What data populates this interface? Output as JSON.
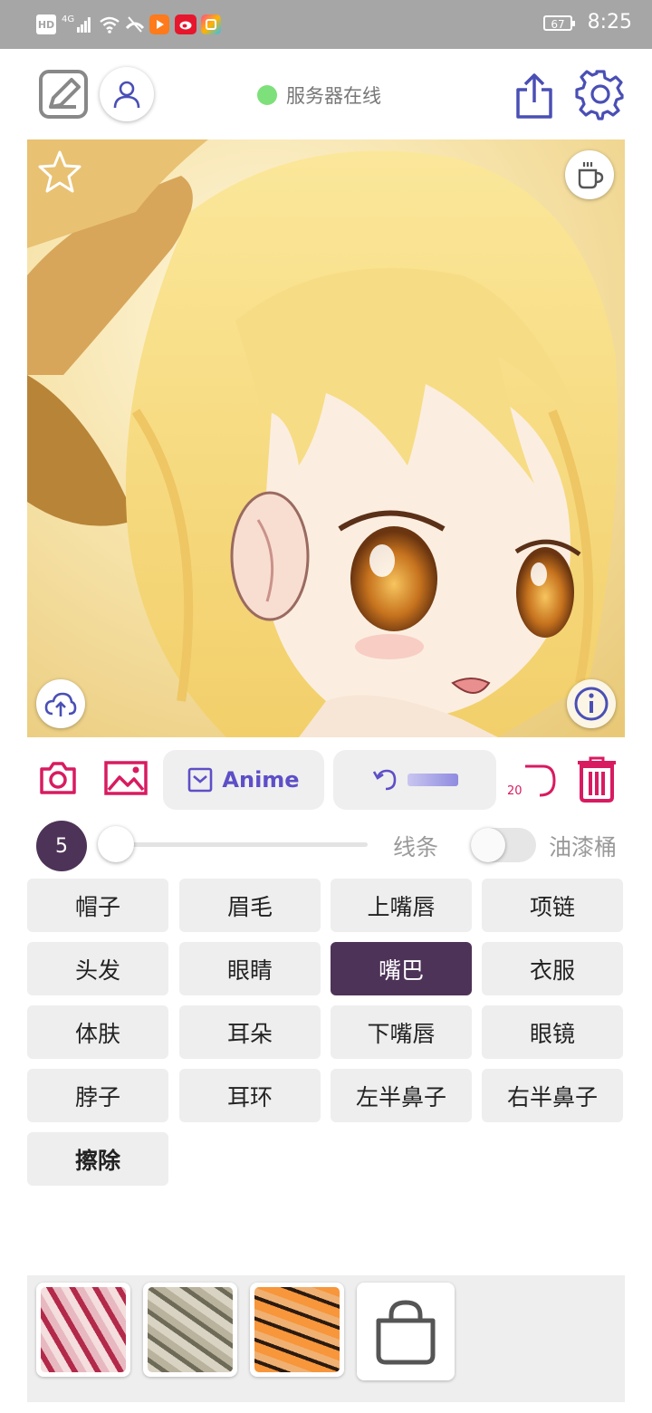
{
  "status_bar": {
    "hd": "HD",
    "network": "4G",
    "battery": "67",
    "time": "8:25"
  },
  "header": {
    "server_status": "服务器在线",
    "status_color": "#7ee07a"
  },
  "icons": {
    "edit": "edit-icon",
    "user": "user-icon",
    "share": "share-icon",
    "settings": "gear-icon",
    "favorite": "star-icon",
    "coffee": "coffee-icon",
    "upload": "cloud-upload-icon",
    "info": "info-icon",
    "camera": "camera-icon",
    "gallery": "image-icon",
    "undo": "undo-icon",
    "redo": "redo-icon",
    "delete": "trash-icon",
    "shop": "shopping-bag-icon"
  },
  "toolbar": {
    "anime_label": "Anime",
    "redo_count": "20"
  },
  "brush": {
    "size": "5",
    "slider_value": 0,
    "mode_line_label": "线条",
    "mode_fill_label": "油漆桶",
    "fill_enabled": false
  },
  "parts": [
    {
      "label": "帽子",
      "active": false
    },
    {
      "label": "眉毛",
      "active": false
    },
    {
      "label": "上嘴唇",
      "active": false
    },
    {
      "label": "项链",
      "active": false
    },
    {
      "label": "头发",
      "active": false
    },
    {
      "label": "眼睛",
      "active": false
    },
    {
      "label": "嘴巴",
      "active": true
    },
    {
      "label": "衣服",
      "active": false
    },
    {
      "label": "体肤",
      "active": false
    },
    {
      "label": "耳朵",
      "active": false
    },
    {
      "label": "下嘴唇",
      "active": false
    },
    {
      "label": "眼镜",
      "active": false
    },
    {
      "label": "脖子",
      "active": false
    },
    {
      "label": "耳环",
      "active": false
    },
    {
      "label": "左半鼻子",
      "active": false
    },
    {
      "label": "右半鼻子",
      "active": false
    },
    {
      "label": "擦除",
      "active": false
    }
  ],
  "colors": {
    "accent_purple": "#4e3358",
    "brand_blue": "#4a4fb5",
    "accent_pink": "#d81b60",
    "anime_blue": "#5d4fc7"
  }
}
